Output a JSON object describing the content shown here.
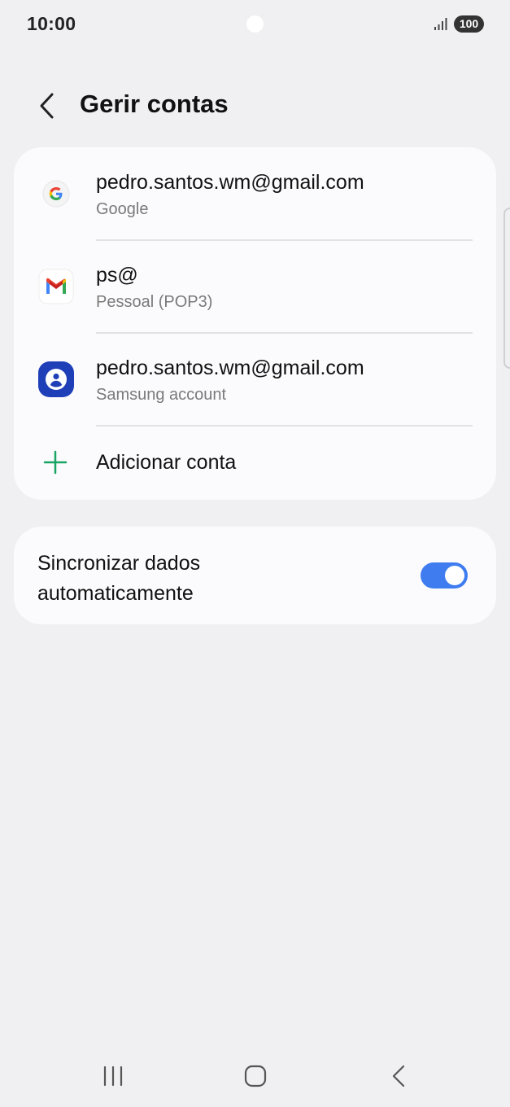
{
  "status_bar": {
    "time": "10:00",
    "battery": "100",
    "signal_icon": "signal-bars-icon"
  },
  "header": {
    "back_icon": "chevron-left-icon",
    "title": "Gerir contas"
  },
  "accounts": [
    {
      "icon": "google-icon",
      "title": "pedro.santos.wm@gmail.com",
      "subtitle": "Google"
    },
    {
      "icon": "gmail-icon",
      "title": "ps@",
      "subtitle": "Pessoal (POP3)"
    },
    {
      "icon": "samsung-account-icon",
      "title": "pedro.santos.wm@gmail.com",
      "subtitle": "Samsung account"
    }
  ],
  "add_account": {
    "icon": "plus-icon",
    "label": "Adicionar conta"
  },
  "sync": {
    "line1": "Sincronizar dados",
    "line2": "automaticamente",
    "enabled": true
  },
  "nav_bar": {
    "recents_icon": "recents-icon",
    "home_icon": "home-icon",
    "back_icon": "back-icon"
  },
  "colors": {
    "background": "#f0f0f3",
    "card": "#fbfbfd",
    "toggle_on": "#3e7cf0",
    "add_green": "#19a463",
    "samsung_blue": "#1f3fb8"
  }
}
